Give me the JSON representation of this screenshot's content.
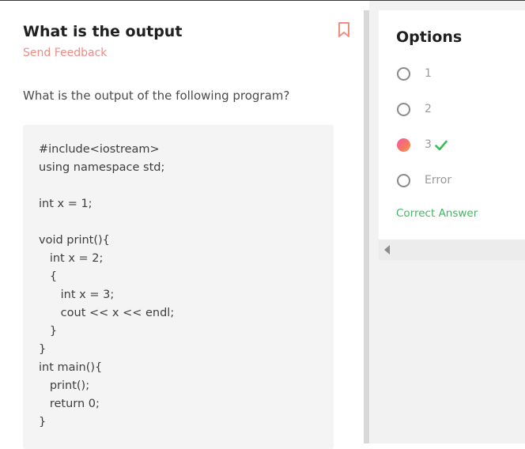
{
  "question": {
    "title": "What is the output",
    "feedback_label": "Send Feedback",
    "prompt": "What is the output of the following program?",
    "code_lines": [
      "#include<iostream>",
      "using namespace std;",
      "",
      "int x = 1;",
      "",
      "void print(){",
      "   int x = 2;",
      "   {",
      "      int x = 3;",
      "      cout << x << endl;",
      "   }",
      "}",
      "int main(){",
      "   print();",
      "   return 0;",
      "}"
    ]
  },
  "options": {
    "title": "Options",
    "items": [
      {
        "label": "1",
        "selected": false,
        "correct": false
      },
      {
        "label": "2",
        "selected": false,
        "correct": false
      },
      {
        "label": "3",
        "selected": true,
        "correct": true
      },
      {
        "label": "Error",
        "selected": false,
        "correct": false
      }
    ],
    "correct_answer_label": "Correct Answer"
  },
  "colors": {
    "accent": "#f28b82",
    "correct": "#3dba5d",
    "selected_gradient_start": "#f857a6",
    "selected_gradient_end": "#f5a25d"
  },
  "icons": {
    "bookmark": "bookmark-icon",
    "check": "checkmark-icon",
    "scroll_left": "chevron-left-icon"
  }
}
